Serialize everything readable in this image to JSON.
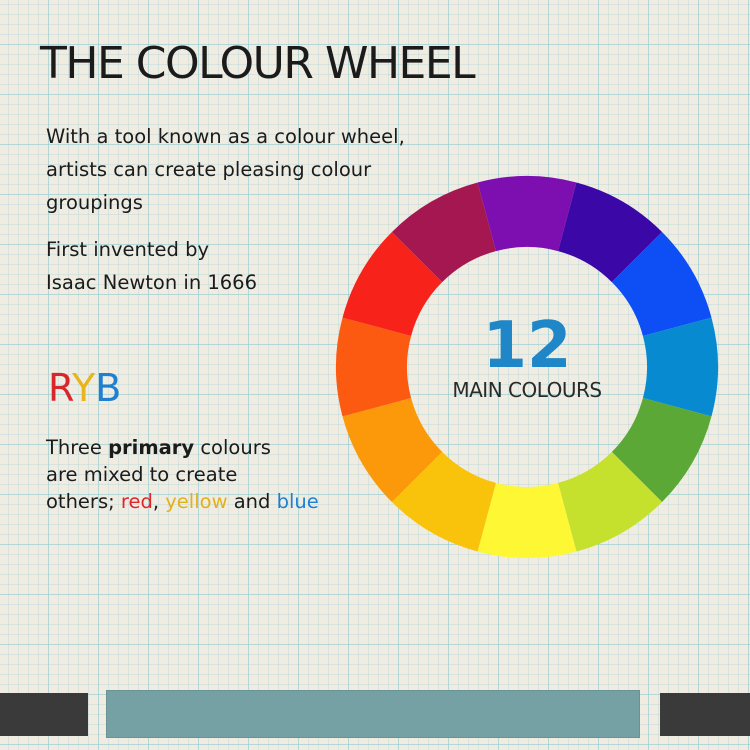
{
  "title": "THE COLOUR WHEEL",
  "intro": "With a tool known as a colour wheel, artists can create pleasing colour groupings",
  "invented_line1": "First invented by",
  "invented_line2": "Isaac Newton in 1666",
  "ryb": {
    "r": "R",
    "y": "Y",
    "b": "B",
    "colors": {
      "r": "#d9262c",
      "y": "#e8b51a",
      "b": "#1f7fd0"
    }
  },
  "primary": {
    "line1_pre": "Three ",
    "line1_bold": "primary",
    "line1_post": " colours",
    "line2": "are mixed to create",
    "line3_pre": "others; ",
    "red": "red",
    "comma_after_red": ", ",
    "yellow": "yellow",
    "and": " and ",
    "blue": "blue",
    "colors": {
      "red": "#e0242b",
      "yellow": "#e3b01d",
      "blue": "#1f7fd0"
    }
  },
  "wheel": {
    "number": "12",
    "label": "MAIN COLOURS",
    "segments": [
      {
        "color": "#7d0eb0"
      },
      {
        "color": "#3b07a6"
      },
      {
        "color": "#0d4ff5"
      },
      {
        "color": "#088ad0"
      },
      {
        "color": "#5ba836"
      },
      {
        "color": "#c5e12e"
      },
      {
        "color": "#fdf734"
      },
      {
        "color": "#f9c20b"
      },
      {
        "color": "#fb990a"
      },
      {
        "color": "#fc5a10"
      },
      {
        "color": "#f7221a"
      },
      {
        "color": "#a41751"
      }
    ]
  }
}
